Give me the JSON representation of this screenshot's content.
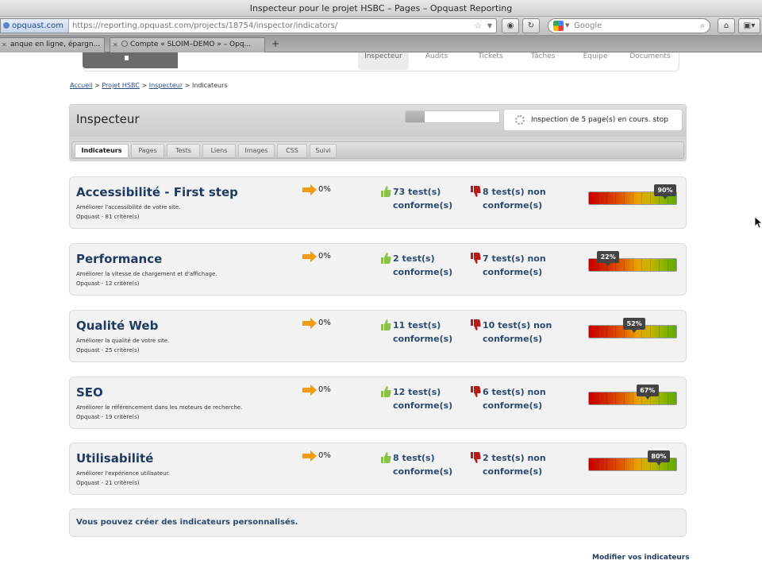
{
  "window": {
    "title": "Inspecteur pour le projet HSBC – Pages – Opquast Reporting"
  },
  "toolbar": {
    "url_site": "opquast.com",
    "url_full": "https://reporting.opquast.com/projects/18754/inspector/indicators/",
    "search_placeholder": "Google"
  },
  "tabs": [
    {
      "label": "anque en ligne, épargn..."
    },
    {
      "label": "Compte « SLOIM–DEMO » – Opq..."
    }
  ],
  "sitenav": {
    "items": [
      "Inspecteur",
      "Audits",
      "Tickets",
      "Tâches",
      "Equipe",
      "Documents"
    ]
  },
  "breadcrumb": {
    "home": "Accueil",
    "project": "Projet HSBC",
    "inspector": "Inspecteur",
    "current": "Indicateurs",
    "sep": ">"
  },
  "inspector": {
    "title": "Inspecteur",
    "progress": 0.2,
    "status": "Inspection de 5 page(s) en cours. stop",
    "subtabs": [
      "Indicateurs",
      "Pages",
      "Tests",
      "Liens",
      "Images",
      "CSS",
      "Suivi"
    ]
  },
  "indicators": [
    {
      "title": "Accessibilité - First step",
      "desc": "Améliorer l'accessibilité de votre site.",
      "crit": "Opquast - 81 critère(s)",
      "pct": "0%",
      "ok": "73 test(s)",
      "ok2": "conforme(s)",
      "ko": "8 test(s) non",
      "ko2": "conforme(s)",
      "rate": 90,
      "rate_label": "90%"
    },
    {
      "title": "Performance",
      "desc": "Améliorer la vitesse de chargement et d'affichage.",
      "crit": "Opquast - 12 critère(s)",
      "pct": "0%",
      "ok": "2 test(s)",
      "ok2": "conforme(s)",
      "ko": "7 test(s) non",
      "ko2": "conforme(s)",
      "rate": 22,
      "rate_label": "22%"
    },
    {
      "title": "Qualité Web",
      "desc": "Améliorer la qualité de votre site.",
      "crit": "Opquast - 25 critère(s)",
      "pct": "0%",
      "ok": "11 test(s)",
      "ok2": "conforme(s)",
      "ko": "10 test(s) non",
      "ko2": "conforme(s)",
      "rate": 52,
      "rate_label": "52%"
    },
    {
      "title": "SEO",
      "desc": "Améliorer le référencement dans les moteurs de recherche.",
      "crit": "Opquast - 19 critère(s)",
      "pct": "0%",
      "ok": "12 test(s)",
      "ok2": "conforme(s)",
      "ko": "6 test(s) non",
      "ko2": "conforme(s)",
      "rate": 67,
      "rate_label": "67%"
    },
    {
      "title": "Utilisabilité",
      "desc": "Améliorer l'expérience utilisateur.",
      "crit": "Opquast - 21 critère(s)",
      "pct": "0%",
      "ok": "8 test(s)",
      "ok2": "conforme(s)",
      "ko": "2 test(s) non",
      "ko2": "conforme(s)",
      "rate": 80,
      "rate_label": "80%"
    }
  ],
  "footer": {
    "custom_note": "Vous pouvez créer des indicateurs personnalisés.",
    "modify_link": "Modifier vos indicateurs"
  },
  "colors": {
    "accent": "#1e3a5f",
    "ok": "#8bc34a",
    "ko": "#b71c1c",
    "arrow": "#f39c12"
  }
}
